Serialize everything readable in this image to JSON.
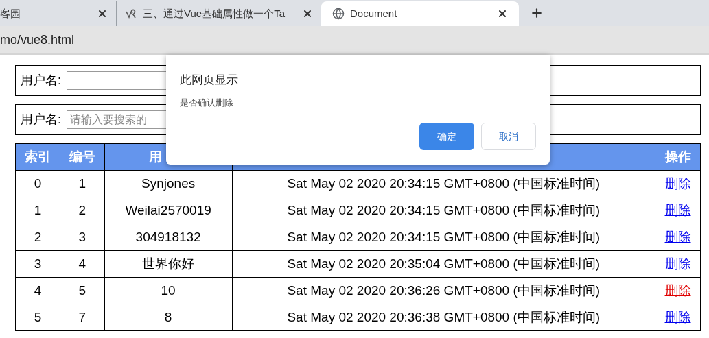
{
  "tabs": [
    {
      "title": "客园",
      "selected": false,
      "kind": "plain"
    },
    {
      "title": "三、通过Vue基础属性做一个Ta",
      "selected": false,
      "kind": "site"
    },
    {
      "title": "Document",
      "selected": true,
      "kind": "page"
    }
  ],
  "address": "mo/vue8.html",
  "forms": [
    {
      "label": "用户名:"
    },
    {
      "label": "用户名:",
      "placeholder": "请输入要搜索的"
    }
  ],
  "table": {
    "columns": [
      {
        "label": "索引"
      },
      {
        "label": "编号"
      },
      {
        "label": "用"
      },
      {},
      {
        "label": "操作"
      }
    ],
    "rows": [
      {
        "index": "0",
        "id": "1",
        "name": "Synjones",
        "time": "Sat May 02 2020 20:34:15 GMT+0800 (中国标准时间)",
        "action": "删除",
        "highlighted": false
      },
      {
        "index": "1",
        "id": "2",
        "name": "Weilai2570019",
        "time": "Sat May 02 2020 20:34:15 GMT+0800 (中国标准时间)",
        "action": "删除",
        "highlighted": false
      },
      {
        "index": "2",
        "id": "3",
        "name": "304918132",
        "time": "Sat May 02 2020 20:34:15 GMT+0800 (中国标准时间)",
        "action": "删除",
        "highlighted": false
      },
      {
        "index": "3",
        "id": "4",
        "name": "世界你好",
        "time": "Sat May 02 2020 20:35:04 GMT+0800 (中国标准时间)",
        "action": "删除",
        "highlighted": false
      },
      {
        "index": "4",
        "id": "5",
        "name": "10",
        "time": "Sat May 02 2020 20:36:26 GMT+0800 (中国标准时间)",
        "action": "删除",
        "highlighted": true
      },
      {
        "index": "5",
        "id": "7",
        "name": "8",
        "time": "Sat May 02 2020 20:36:38 GMT+0800 (中国标准时间)",
        "action": "删除",
        "highlighted": false
      }
    ]
  },
  "dialog": {
    "title": "此网页显示",
    "message": "是否确认删除",
    "buttons": [
      {
        "label": "确定",
        "kind": "primary"
      },
      {
        "label": "取消",
        "kind": "secondary"
      }
    ]
  }
}
